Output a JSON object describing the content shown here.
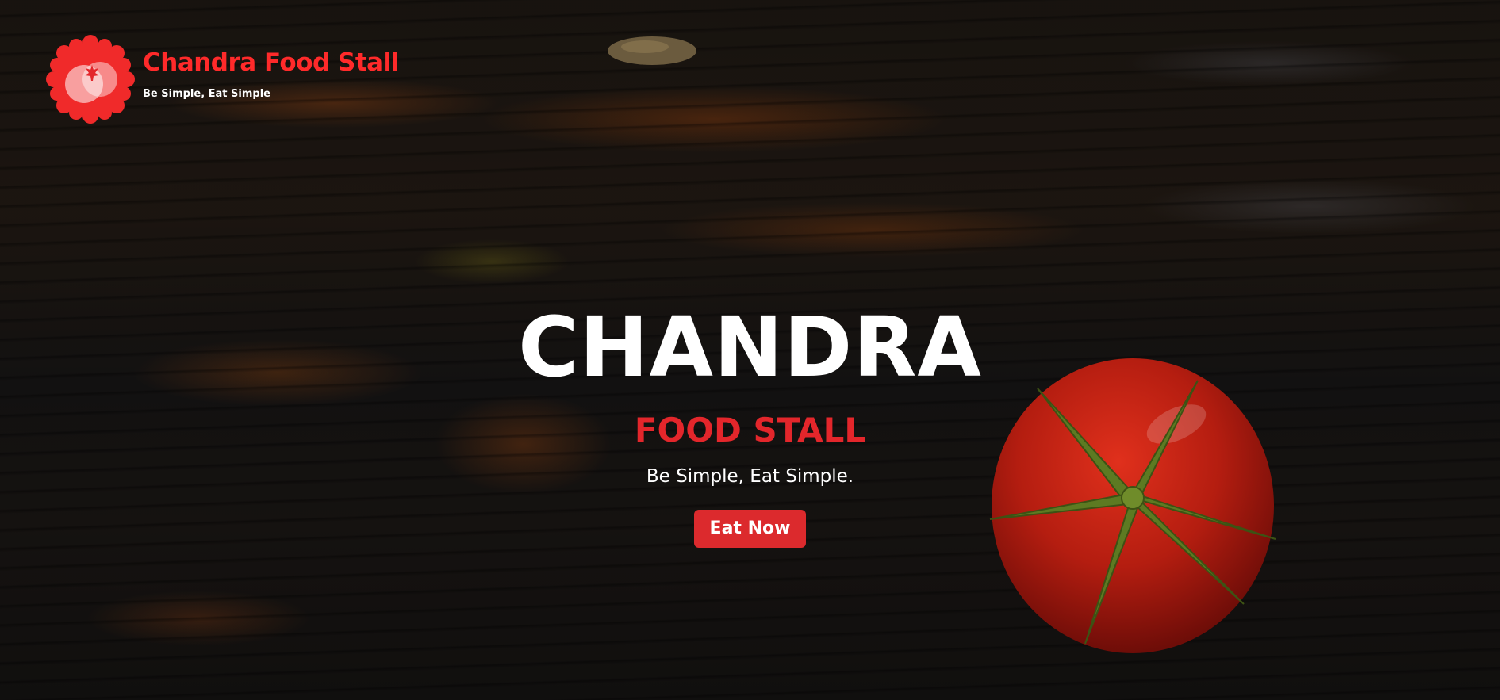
{
  "brand": {
    "name": "Chandra Food Stall",
    "tagline": "Be Simple, Eat Simple",
    "logo_icon": "flower-badge-icon",
    "accent_color": "#ff2a2a"
  },
  "hero": {
    "title": "CHANDRA",
    "subtitle": "FOOD STALL",
    "tagline": "Be Simple, Eat Simple.",
    "cta_label": "Eat Now",
    "cta_color": "#dc2a2d",
    "decoration_icon": "tomato-icon"
  }
}
